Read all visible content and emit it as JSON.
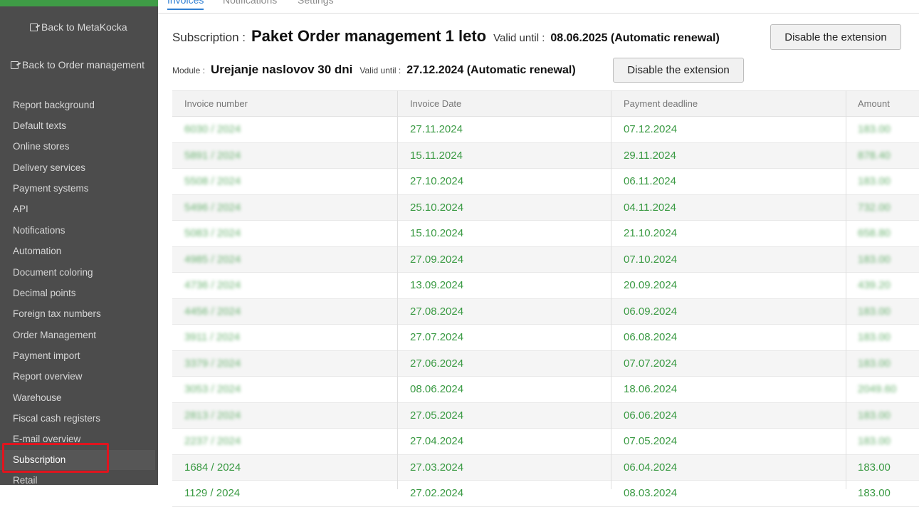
{
  "sidebar": {
    "back_links": [
      {
        "label": "Back to MetaKocka",
        "icon": "external-link-icon"
      },
      {
        "label": "Back to Order management",
        "icon": "external-link-icon"
      }
    ],
    "items": [
      "Report background",
      "Default texts",
      "Online stores",
      "Delivery services",
      "Payment systems",
      "API",
      "Notifications",
      "Automation",
      "Document coloring",
      "Decimal points",
      "Foreign tax numbers",
      "Order Management",
      "Payment import",
      "Report overview",
      "Warehouse",
      "Fiscal cash registers",
      "E-mail overview",
      "Subscription",
      "Retail"
    ],
    "active_item": "Subscription"
  },
  "tabs": [
    {
      "label": "Invoices",
      "active": true
    },
    {
      "label": "Notifications",
      "active": false
    },
    {
      "label": "Settings",
      "active": false
    }
  ],
  "subscription": {
    "label": "Subscription :",
    "name": "Paket Order management 1 leto",
    "valid_label": "Valid until :",
    "valid_value": "08.06.2025 (Automatic renewal)",
    "button": "Disable the extension"
  },
  "module": {
    "label": "Module :",
    "name": "Urejanje naslovov 30 dni",
    "valid_label": "Valid until :",
    "valid_value": "27.12.2024 (Automatic renewal)",
    "button": "Disable the extension"
  },
  "table": {
    "columns": [
      "Invoice number",
      "Invoice Date",
      "Payment deadline",
      "Amount"
    ],
    "rows": [
      {
        "number": "6030 / 2024",
        "date": "27.11.2024",
        "deadline": "07.12.2024",
        "amount": "183.00",
        "blurred": true
      },
      {
        "number": "5891 / 2024",
        "date": "15.11.2024",
        "deadline": "29.11.2024",
        "amount": "878.40",
        "blurred": true
      },
      {
        "number": "5508 / 2024",
        "date": "27.10.2024",
        "deadline": "06.11.2024",
        "amount": "183.00",
        "blurred": true
      },
      {
        "number": "5496 / 2024",
        "date": "25.10.2024",
        "deadline": "04.11.2024",
        "amount": "732.00",
        "blurred": true
      },
      {
        "number": "5083 / 2024",
        "date": "15.10.2024",
        "deadline": "21.10.2024",
        "amount": "658.80",
        "blurred": true
      },
      {
        "number": "4985 / 2024",
        "date": "27.09.2024",
        "deadline": "07.10.2024",
        "amount": "183.00",
        "blurred": true
      },
      {
        "number": "4736 / 2024",
        "date": "13.09.2024",
        "deadline": "20.09.2024",
        "amount": "439.20",
        "blurred": true
      },
      {
        "number": "4456 / 2024",
        "date": "27.08.2024",
        "deadline": "06.09.2024",
        "amount": "183.00",
        "blurred": true
      },
      {
        "number": "3911 / 2024",
        "date": "27.07.2024",
        "deadline": "06.08.2024",
        "amount": "183.00",
        "blurred": true
      },
      {
        "number": "3379 / 2024",
        "date": "27.06.2024",
        "deadline": "07.07.2024",
        "amount": "183.00",
        "blurred": true
      },
      {
        "number": "3053 / 2024",
        "date": "08.06.2024",
        "deadline": "18.06.2024",
        "amount": "2049.60",
        "blurred": true
      },
      {
        "number": "2813 / 2024",
        "date": "27.05.2024",
        "deadline": "06.06.2024",
        "amount": "183.00",
        "blurred": true
      },
      {
        "number": "2237 / 2024",
        "date": "27.04.2024",
        "deadline": "07.05.2024",
        "amount": "183.00",
        "blurred": true
      },
      {
        "number": "1684 / 2024",
        "date": "27.03.2024",
        "deadline": "06.04.2024",
        "amount": "183.00",
        "blurred": false
      },
      {
        "number": "1129 / 2024",
        "date": "27.02.2024",
        "deadline": "08.03.2024",
        "amount": "183.00",
        "blurred": false
      }
    ]
  },
  "colors": {
    "sidebar_bg": "#4c4c4c",
    "accent_green": "#3a9a43",
    "tab_active": "#2f7fd3",
    "highlight_red": "#e0141e"
  }
}
